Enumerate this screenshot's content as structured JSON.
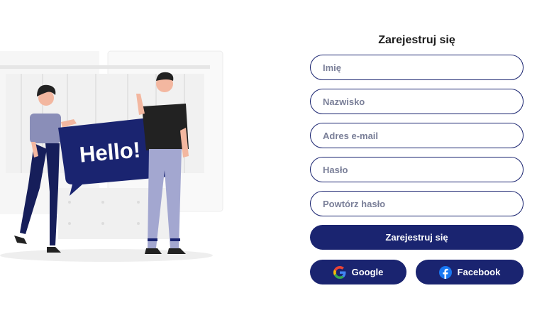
{
  "illustration": {
    "speech_text": "Hello!"
  },
  "form": {
    "title": "Zarejestruj się",
    "fields": [
      {
        "placeholder": "Imię"
      },
      {
        "placeholder": "Nazwisko"
      },
      {
        "placeholder": "Adres e-mail"
      },
      {
        "placeholder": "Hasło"
      },
      {
        "placeholder": "Powtórz hasło"
      }
    ],
    "submit_label": "Zarejestruj się",
    "social": {
      "google_label": "Google",
      "facebook_label": "Facebook"
    }
  },
  "colors": {
    "primary": "#1a2470",
    "placeholder": "#7a7f98"
  }
}
